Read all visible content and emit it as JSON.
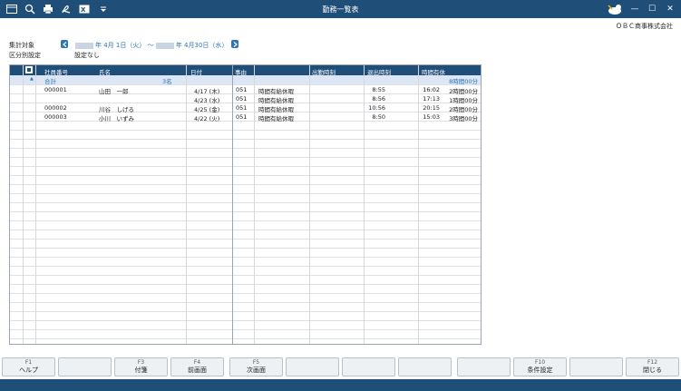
{
  "window": {
    "title": "勤務一覧表",
    "controls": [
      "—",
      "☐",
      "✕"
    ]
  },
  "toolbar_icons": [
    "window-icon",
    "zoom-icon",
    "print-icon",
    "pdf-icon",
    "excel-icon",
    "dropdown-icon"
  ],
  "company": "ＯＢＣ商事株式会社",
  "info": {
    "target_label": "集計対象",
    "period_start": "年 4月 1日（火）",
    "period_sep": "～",
    "period_end": "年 4月30日（水）",
    "group_label": "区分別設定",
    "group_value": "設定なし"
  },
  "columns": [
    "社員番号",
    "氏名",
    "日付",
    "事由",
    "出勤時刻",
    "退出時刻",
    "時間有休"
  ],
  "total": {
    "label": "合計",
    "count": "3名",
    "paid": "8時間00分"
  },
  "rows": [
    {
      "emp": "000001",
      "name": "山田　一郎",
      "date": "4/17 (木)",
      "code": "051",
      "reason": "時間有給休暇",
      "in": "8:55",
      "out": "16:02",
      "paid": "2時間00分"
    },
    {
      "emp": "",
      "name": "",
      "date": "4/23 (水)",
      "code": "051",
      "reason": "時間有給休暇",
      "in": "8:56",
      "out": "17:13",
      "paid": "1時間00分"
    },
    {
      "emp": "000002",
      "name": "川谷　しげる",
      "date": "4/25 (金)",
      "code": "051",
      "reason": "時間有給休暇",
      "in": "10:56",
      "out": "20:15",
      "paid": "2時間00分"
    },
    {
      "emp": "000003",
      "name": "小川　いずみ",
      "date": "4/22 (火)",
      "code": "051",
      "reason": "時間有給休暇",
      "in": "8:50",
      "out": "15:03",
      "paid": "3時間00分"
    }
  ],
  "fkeys": [
    {
      "fn": "F1",
      "label": "ヘルプ"
    },
    {
      "fn": "",
      "label": ""
    },
    {
      "fn": "F3",
      "label": "付箋"
    },
    {
      "fn": "F4",
      "label": "前画面"
    },
    {
      "fn": "F5",
      "label": "次画面"
    },
    {
      "fn": "",
      "label": ""
    },
    {
      "fn": "",
      "label": ""
    },
    {
      "fn": "",
      "label": ""
    },
    {
      "fn": "",
      "label": ""
    },
    {
      "fn": "F10",
      "label": "条件設定"
    },
    {
      "fn": "",
      "label": ""
    },
    {
      "fn": "F12",
      "label": "閉じる"
    }
  ]
}
